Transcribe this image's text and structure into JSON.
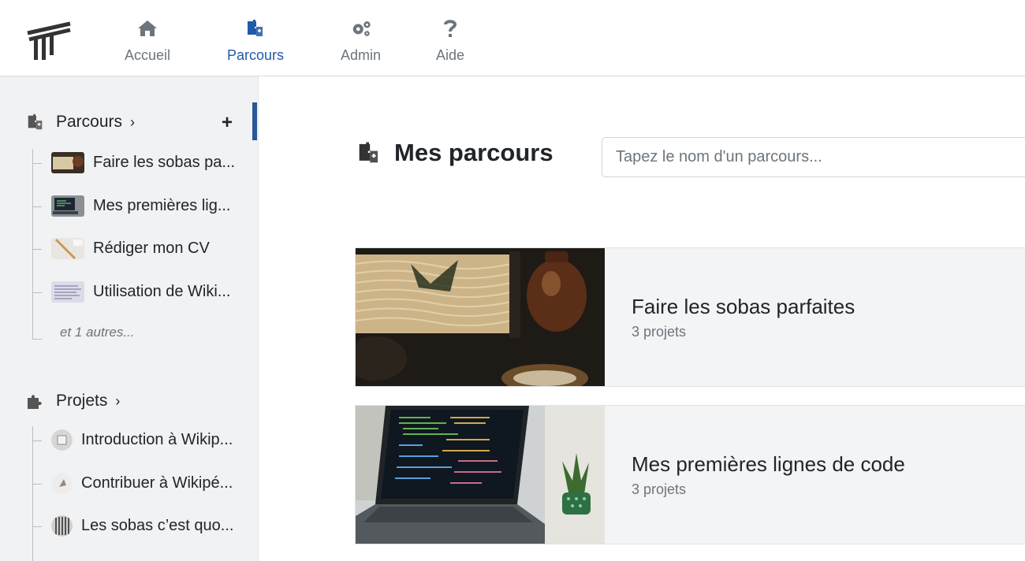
{
  "nav": {
    "items": [
      {
        "label": "Accueil",
        "icon": "home-icon"
      },
      {
        "label": "Parcours",
        "icon": "puzzle-path-icon",
        "active": true
      },
      {
        "label": "Admin",
        "icon": "gears-icon"
      },
      {
        "label": "Aide",
        "icon": "question-icon"
      }
    ]
  },
  "sidebar": {
    "parcours_header": "Parcours",
    "parcours_items": [
      {
        "label": "Faire les sobas pa..."
      },
      {
        "label": "Mes premières lig..."
      },
      {
        "label": "Rédiger mon CV"
      },
      {
        "label": "Utilisation de Wiki..."
      }
    ],
    "parcours_more": "et 1 autres...",
    "projets_header": "Projets",
    "projets_items": [
      {
        "label": "Introduction à Wikip..."
      },
      {
        "label": "Contribuer à Wikipé..."
      },
      {
        "label": "Les sobas c’est quo..."
      }
    ]
  },
  "main": {
    "title": "Mes parcours",
    "search_placeholder": "Tapez le nom d'un parcours...",
    "cards": [
      {
        "title": "Faire les sobas parfaites",
        "subtitle": "3 projets"
      },
      {
        "title": "Mes premières lignes de code",
        "subtitle": "3 projets"
      }
    ]
  },
  "colors": {
    "accent": "#1f5ba8",
    "sidebar_bg": "#f1f2f4",
    "card_bg": "#f3f4f6"
  }
}
